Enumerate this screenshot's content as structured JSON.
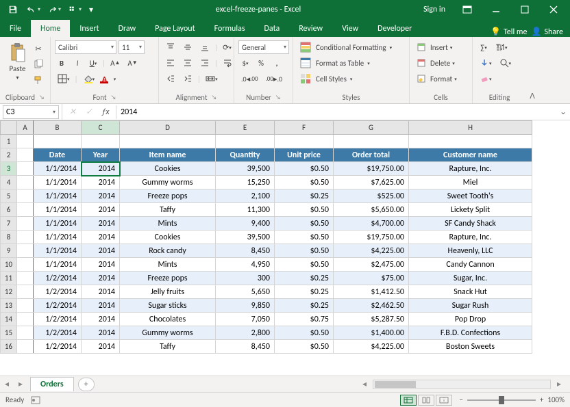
{
  "titlebar": {
    "center": "excel-freeze-panes - Excel",
    "signin": "Sign in"
  },
  "tabs": [
    "File",
    "Home",
    "Insert",
    "Draw",
    "Page Layout",
    "Formulas",
    "Data",
    "Review",
    "View",
    "Developer"
  ],
  "active_tab": "Home",
  "tabs_right": {
    "tellme": "Tell me",
    "share": "Share"
  },
  "ribbon": {
    "clipboard": {
      "paste": "Paste",
      "label": "Clipboard"
    },
    "font": {
      "family": "Calibri",
      "size": "11",
      "label": "Font"
    },
    "alignment": {
      "label": "Alignment"
    },
    "number": {
      "format": "General",
      "label": "Number"
    },
    "styles": {
      "cond": "Conditional Formatting",
      "table": "Format as Table",
      "cell": "Cell Styles",
      "label": "Styles"
    },
    "cells": {
      "insert": "Insert",
      "delete": "Delete",
      "format": "Format",
      "label": "Cells"
    },
    "editing": {
      "label": "Editing"
    }
  },
  "fbar": {
    "name": "C3",
    "formula": "2014"
  },
  "columns": [
    "A",
    "B",
    "C",
    "D",
    "E",
    "F",
    "G",
    "H"
  ],
  "headers": [
    "Date",
    "Year",
    "Item name",
    "Quantity",
    "Unit price",
    "Order total",
    "Customer name"
  ],
  "rows": [
    {
      "n": 3,
      "d": "1/1/2014",
      "y": "2014",
      "item": "Cookies",
      "qty": "39,500",
      "unit": "$0.50",
      "tot": "$19,750.00",
      "cust": "Rapture, Inc."
    },
    {
      "n": 4,
      "d": "1/1/2014",
      "y": "2014",
      "item": "Gummy worms",
      "qty": "15,250",
      "unit": "$0.50",
      "tot": "$7,625.00",
      "cust": "Miel"
    },
    {
      "n": 5,
      "d": "1/1/2014",
      "y": "2014",
      "item": "Freeze pops",
      "qty": "2,100",
      "unit": "$0.25",
      "tot": "$525.00",
      "cust": "Sweet Tooth's"
    },
    {
      "n": 6,
      "d": "1/1/2014",
      "y": "2014",
      "item": "Taffy",
      "qty": "11,300",
      "unit": "$0.50",
      "tot": "$5,650.00",
      "cust": "Lickety Split"
    },
    {
      "n": 7,
      "d": "1/1/2014",
      "y": "2014",
      "item": "Mints",
      "qty": "9,400",
      "unit": "$0.50",
      "tot": "$4,700.00",
      "cust": "SF Candy Shack"
    },
    {
      "n": 8,
      "d": "1/1/2014",
      "y": "2014",
      "item": "Cookies",
      "qty": "39,500",
      "unit": "$0.50",
      "tot": "$19,750.00",
      "cust": "Rapture, Inc."
    },
    {
      "n": 9,
      "d": "1/1/2014",
      "y": "2014",
      "item": "Rock candy",
      "qty": "8,450",
      "unit": "$0.50",
      "tot": "$4,225.00",
      "cust": "Heavenly, LLC"
    },
    {
      "n": 10,
      "d": "1/1/2014",
      "y": "2014",
      "item": "Mints",
      "qty": "4,950",
      "unit": "$0.50",
      "tot": "$2,475.00",
      "cust": "Candy Cannon"
    },
    {
      "n": 11,
      "d": "1/2/2014",
      "y": "2014",
      "item": "Freeze pops",
      "qty": "300",
      "unit": "$0.25",
      "tot": "$75.00",
      "cust": "Sugar, Inc."
    },
    {
      "n": 12,
      "d": "1/2/2014",
      "y": "2014",
      "item": "Jelly fruits",
      "qty": "5,650",
      "unit": "$0.25",
      "tot": "$1,412.50",
      "cust": "Snack Hut"
    },
    {
      "n": 13,
      "d": "1/2/2014",
      "y": "2014",
      "item": "Sugar sticks",
      "qty": "9,850",
      "unit": "$0.25",
      "tot": "$2,462.50",
      "cust": "Sugar Rush"
    },
    {
      "n": 14,
      "d": "1/2/2014",
      "y": "2014",
      "item": "Chocolates",
      "qty": "7,050",
      "unit": "$0.75",
      "tot": "$5,287.50",
      "cust": "Pop Drop"
    },
    {
      "n": 15,
      "d": "1/2/2014",
      "y": "2014",
      "item": "Gummy worms",
      "qty": "2,800",
      "unit": "$0.50",
      "tot": "$1,400.00",
      "cust": "F.B.D. Confections"
    },
    {
      "n": 16,
      "d": "1/2/2014",
      "y": "2014",
      "item": "Taffy",
      "qty": "8,450",
      "unit": "$0.50",
      "tot": "$4,225.00",
      "cust": "Boston Sweets"
    }
  ],
  "sheet_tab": "Orders",
  "status": {
    "ready": "Ready",
    "zoom": "100%"
  },
  "selection": {
    "cell": "C3",
    "col": "C",
    "row": 3
  }
}
